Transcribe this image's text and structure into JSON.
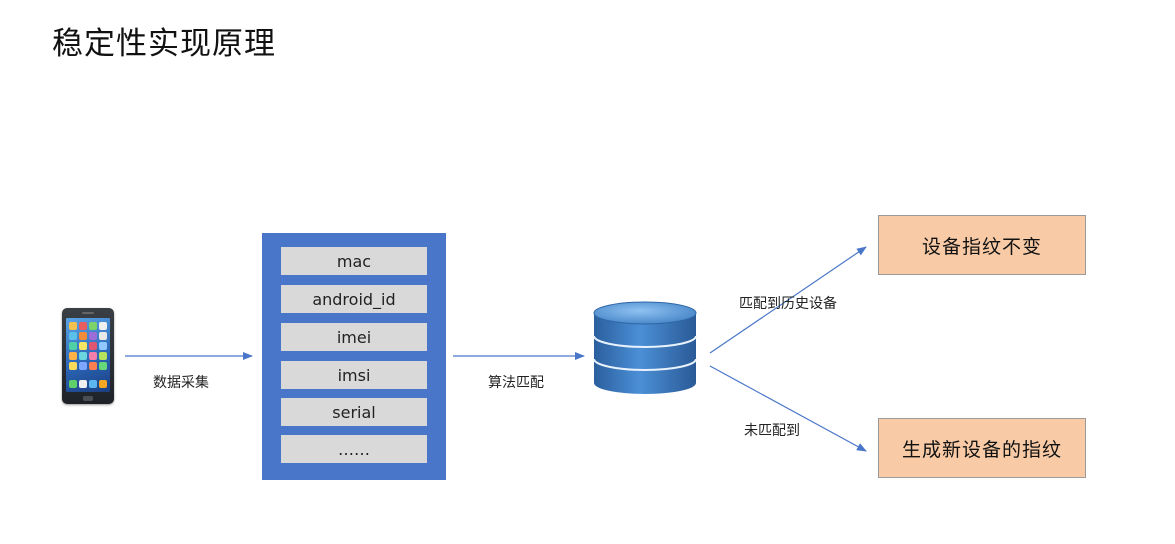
{
  "title": "稳定性实现原理",
  "fields": [
    "mac",
    "android_id",
    "imei",
    "imsi",
    "serial",
    "……"
  ],
  "labels": {
    "collect": "数据采集",
    "match_algo": "算法匹配",
    "matched": "匹配到历史设备",
    "unmatched": "未匹配到"
  },
  "results": {
    "unchanged": "设备指纹不变",
    "new_fingerprint": "生成新设备的指纹"
  },
  "colors": {
    "panel": "#4a76c9",
    "field": "#d9d9d9",
    "result_box": "#f8cba6",
    "arrow": "#4a76c9",
    "database": "#3f7fc3"
  },
  "icons": {
    "phone": "smartphone-icon",
    "database": "database-icon"
  }
}
